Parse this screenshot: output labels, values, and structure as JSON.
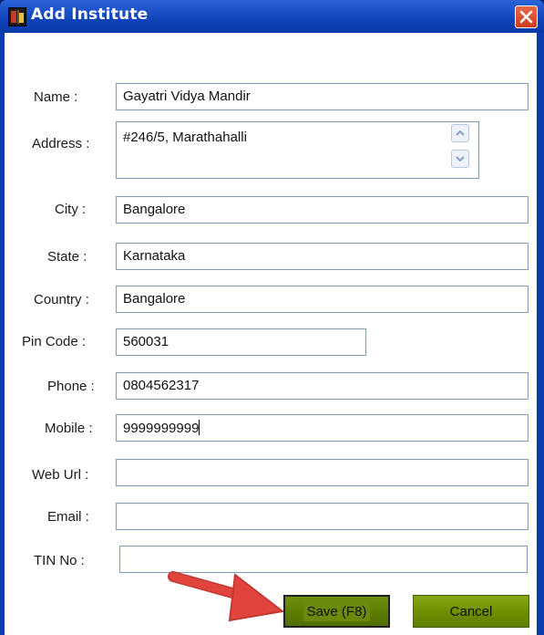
{
  "window": {
    "title": "Add Institute"
  },
  "form": {
    "name": {
      "label": "Name :",
      "value": "Gayatri Vidya Mandir"
    },
    "address": {
      "label": "Address :",
      "value": "#246/5, Marathahalli"
    },
    "city": {
      "label": "City :",
      "value": "Bangalore"
    },
    "state": {
      "label": "State :",
      "value": "Karnataka"
    },
    "country": {
      "label": "Country :",
      "value": "Bangalore"
    },
    "pincode": {
      "label": "Pin Code :",
      "value": "560031"
    },
    "phone": {
      "label": "Phone :",
      "value": "0804562317"
    },
    "mobile": {
      "label": "Mobile :",
      "value": "9999999999"
    },
    "weburl": {
      "label": "Web Url :",
      "value": ""
    },
    "email": {
      "label": "Email :",
      "value": ""
    },
    "tin": {
      "label": "TIN No :",
      "value": ""
    }
  },
  "buttons": {
    "save": "Save (F8)",
    "cancel": "Cancel"
  },
  "colors": {
    "title_bar": "#0d3fb6",
    "button_green": "#6f9000",
    "annotation_arrow": "#e0443c"
  },
  "icons": {
    "window": "app-icon",
    "close": "close-icon",
    "annotation": "red-arrow-annotation"
  }
}
